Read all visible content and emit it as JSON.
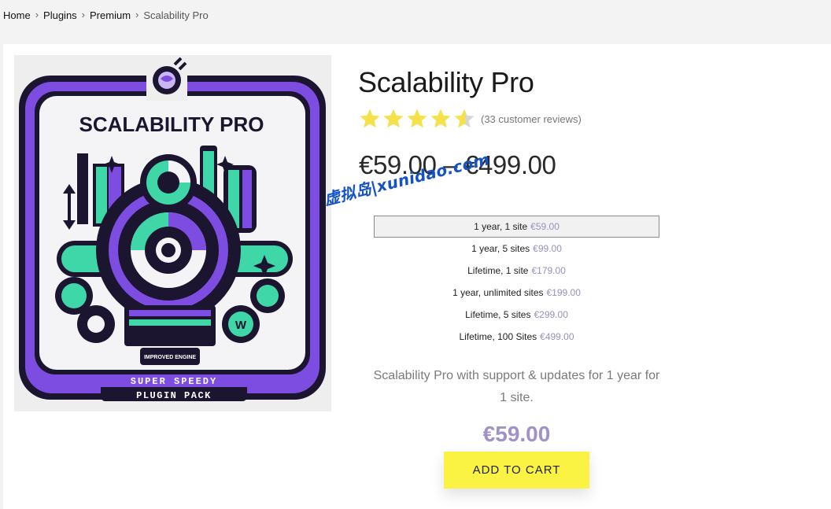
{
  "breadcrumb": {
    "items": [
      "Home",
      "Plugins",
      "Premium"
    ],
    "current": "Scalability Pro"
  },
  "product": {
    "title": "Scalability Pro",
    "rating": {
      "stars": 4.5,
      "max": 5,
      "review_text": "(33 customer reviews)"
    },
    "price_range": "€59.00 – €499.00",
    "options": [
      {
        "label": "1 year, 1 site",
        "price": "€59.00",
        "selected": true
      },
      {
        "label": "1 year, 5 sites",
        "price": "€99.00",
        "selected": false
      },
      {
        "label": "Lifetime, 1 site",
        "price": "€179.00",
        "selected": false
      },
      {
        "label": "1 year, unlimited sites",
        "price": "€199.00",
        "selected": false
      },
      {
        "label": "Lifetime, 5 sites",
        "price": "€299.00",
        "selected": false
      },
      {
        "label": "Lifetime, 100 Sites",
        "price": "€499.00",
        "selected": false
      }
    ],
    "description": "Scalability Pro with support & updates for 1 year for 1 site.",
    "selected_price": "€59.00",
    "add_to_cart_label": "ADD TO CART"
  },
  "image": {
    "heading": "SCALABILITY PRO",
    "banner_line1": "SUPER SPEEDY",
    "banner_line2": "PLUGIN PACK",
    "engine_label": "IMPROVED ENGINE",
    "colors": {
      "purple": "#7c4de0",
      "teal": "#3fd7a8",
      "dark": "#1c1530"
    }
  },
  "watermark": "虚拟岛|xunidao.com",
  "colors": {
    "star": "#f5e14a",
    "cart_button": "#fbf343",
    "price_accent": "#a092c5"
  }
}
